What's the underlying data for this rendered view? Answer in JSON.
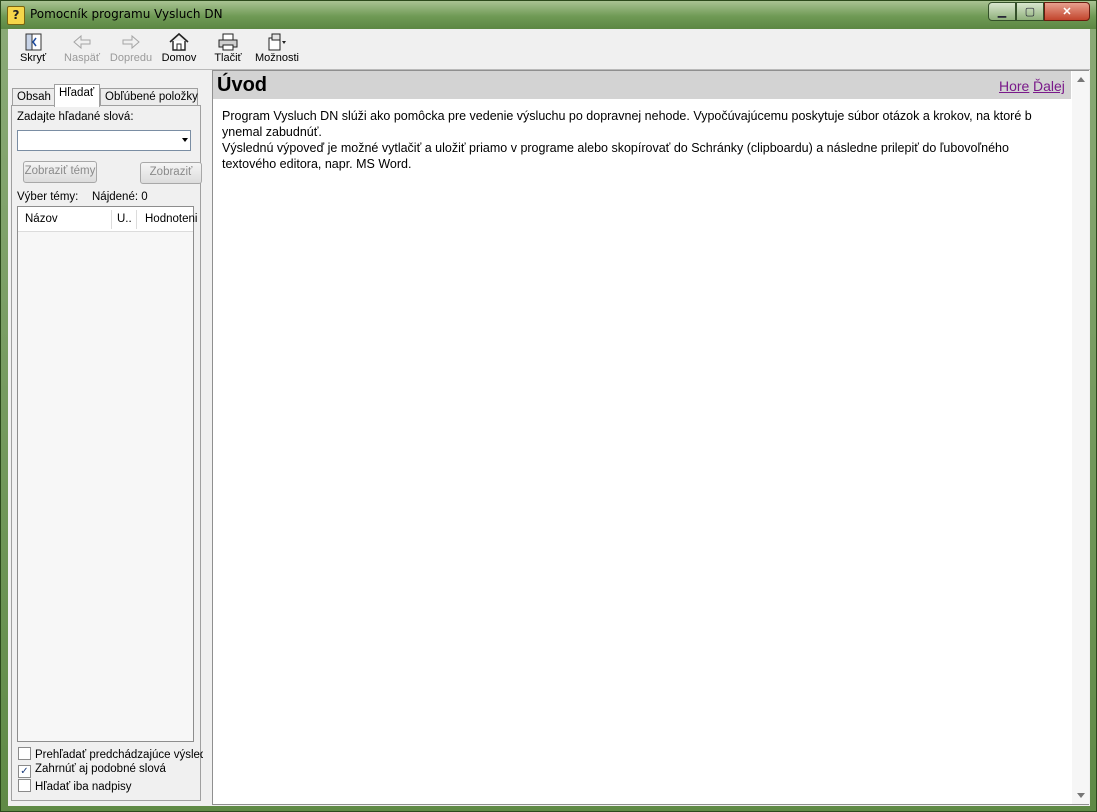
{
  "window": {
    "title": "Pomocník programu Vysluch DN",
    "app_icon": "help-question-icon",
    "controls": {
      "minimize": "minimize-icon",
      "maximize": "maximize-icon",
      "close": "close-icon"
    }
  },
  "toolbar": {
    "buttons": [
      {
        "label": "Skryť",
        "icon": "hide-pane-icon",
        "enabled": true
      },
      {
        "label": "Naspäť",
        "icon": "back-arrow-icon",
        "enabled": false
      },
      {
        "label": "Dopredu",
        "icon": "forward-arrow-icon",
        "enabled": false
      },
      {
        "label": "Domov",
        "icon": "home-icon",
        "enabled": true
      },
      {
        "label": "Tlačiť",
        "icon": "print-icon",
        "enabled": true
      },
      {
        "label": "Možnosti",
        "icon": "options-icon",
        "enabled": true
      }
    ]
  },
  "nav": {
    "tabs": [
      {
        "label": "Obsah",
        "active": false
      },
      {
        "label": "Hľadať",
        "active": true
      },
      {
        "label": "Obľúbené položky",
        "active": false
      }
    ],
    "search": {
      "prompt": "Zadajte hľadané slová:",
      "value": "",
      "list_topics_label": "Zobraziť témy",
      "display_label": "Zobraziť"
    },
    "results": {
      "select_topic_label": "Výber témy:",
      "found_label": "Nájdené: 0",
      "columns": [
        "Názov",
        "U..",
        "Hodnoteni"
      ],
      "rows": []
    },
    "options": [
      {
        "label": "Prehľadať predchádzajúce výsled",
        "checked": false
      },
      {
        "label": "Zahrnúť aj podobné slová",
        "checked": true
      },
      {
        "label": "Hľadať iba nadpisy",
        "checked": false
      }
    ]
  },
  "content": {
    "title": "Úvod",
    "prev_link": "Hore",
    "next_link": "Ďalej",
    "paragraphs": [
      "Program Vysluch DN slúži ako pomôcka pre vedenie výsluchu po dopravnej nehode. Vypočúvajúcemu poskytuje súbor otázok a krokov, na ktoré b ynemal zabudnúť.",
      "Výslednú výpoveď je možné vytlačiť a uložiť priamo v programe alebo skopírovať do Schránky (clipboardu) a následne prilepiť do ľubovoľného textového editora, napr. MS Word."
    ]
  },
  "colors": {
    "link": "#7a1a8a",
    "header_band": "#d3d3d3",
    "disabled_text": "#9a9a9a"
  }
}
